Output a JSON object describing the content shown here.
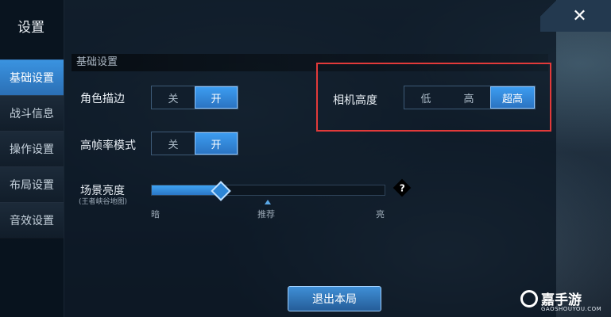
{
  "sidebar": {
    "title": "设置",
    "items": [
      {
        "label": "基础设置",
        "active": true
      },
      {
        "label": "战斗信息",
        "active": false
      },
      {
        "label": "操作设置",
        "active": false
      },
      {
        "label": "布局设置",
        "active": false
      },
      {
        "label": "音效设置",
        "active": false
      }
    ]
  },
  "section_header": "基础设置",
  "settings": {
    "outline": {
      "label": "角色描边",
      "options": [
        "关",
        "开"
      ],
      "selected": "开"
    },
    "high_fps": {
      "label": "高帧率模式",
      "options": [
        "关",
        "开"
      ],
      "selected": "开"
    },
    "camera_height": {
      "label": "相机高度",
      "options": [
        "低",
        "高",
        "超高"
      ],
      "selected": "超高"
    },
    "brightness": {
      "label": "场景亮度",
      "sublabel": "(王者峡谷地图)",
      "min_label": "暗",
      "recommend_label": "推荐",
      "max_label": "亮",
      "value_fraction": 0.3,
      "help": "?"
    }
  },
  "exit_button": "退出本局",
  "close_icon": "close-icon",
  "watermark": {
    "brand": "嘉手游",
    "domain": "GAOSHOUYOU.COM"
  },
  "colors": {
    "accent": "#3c9cf0",
    "highlight_box": "#e23a3a"
  }
}
